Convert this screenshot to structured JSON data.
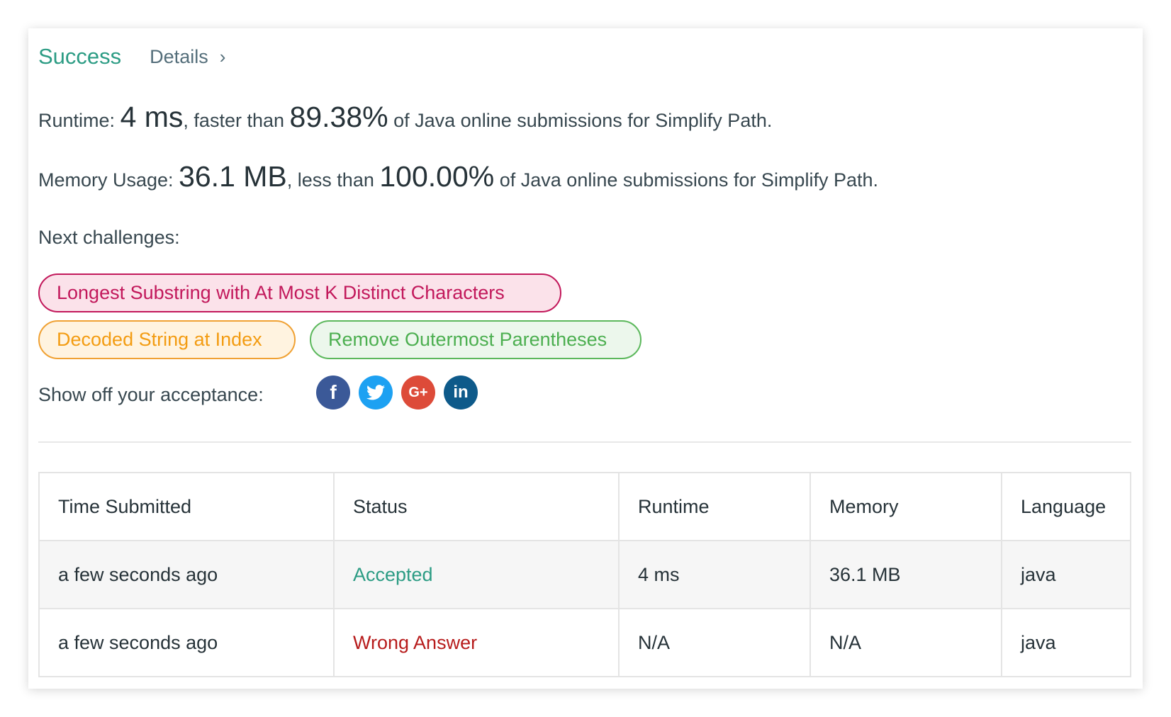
{
  "header": {
    "status": "Success",
    "details_label": "Details",
    "chevron": "›"
  },
  "runtime": {
    "label": "Runtime:",
    "value": "4 ms",
    "comparison": ", faster than",
    "percent": "89.38%",
    "suffix": "of Java online submissions for Simplify Path."
  },
  "memory": {
    "label": "Memory Usage:",
    "value": "36.1 MB",
    "comparison": ", less than",
    "percent": "100.00%",
    "suffix": "of Java online submissions for Simplify Path."
  },
  "next_challenges": {
    "label": "Next challenges:",
    "items": [
      {
        "title": "Longest Substring with At Most K Distinct Characters",
        "difficulty": "hard"
      },
      {
        "title": "Decoded String at Index",
        "difficulty": "medium"
      },
      {
        "title": "Remove Outermost Parentheses",
        "difficulty": "easy"
      }
    ]
  },
  "share": {
    "label": "Show off your acceptance:",
    "icons": [
      "facebook-icon",
      "twitter-icon",
      "google-plus-icon",
      "linkedin-icon"
    ],
    "glyphs": {
      "facebook": "f",
      "google": "G+",
      "linkedin": "in"
    }
  },
  "table": {
    "headers": [
      "Time Submitted",
      "Status",
      "Runtime",
      "Memory",
      "Language"
    ],
    "rows": [
      {
        "time": "a few seconds ago",
        "status": "Accepted",
        "runtime": "4 ms",
        "memory": "36.1 MB",
        "language": "java"
      },
      {
        "time": "a few seconds ago",
        "status": "Wrong Answer",
        "runtime": "N/A",
        "memory": "N/A",
        "language": "java"
      }
    ]
  },
  "colors": {
    "success": "#2c9c84",
    "wrong": "#b71c1c",
    "hard": "#c2185b",
    "medium": "#f39c12",
    "easy": "#4caf50"
  }
}
